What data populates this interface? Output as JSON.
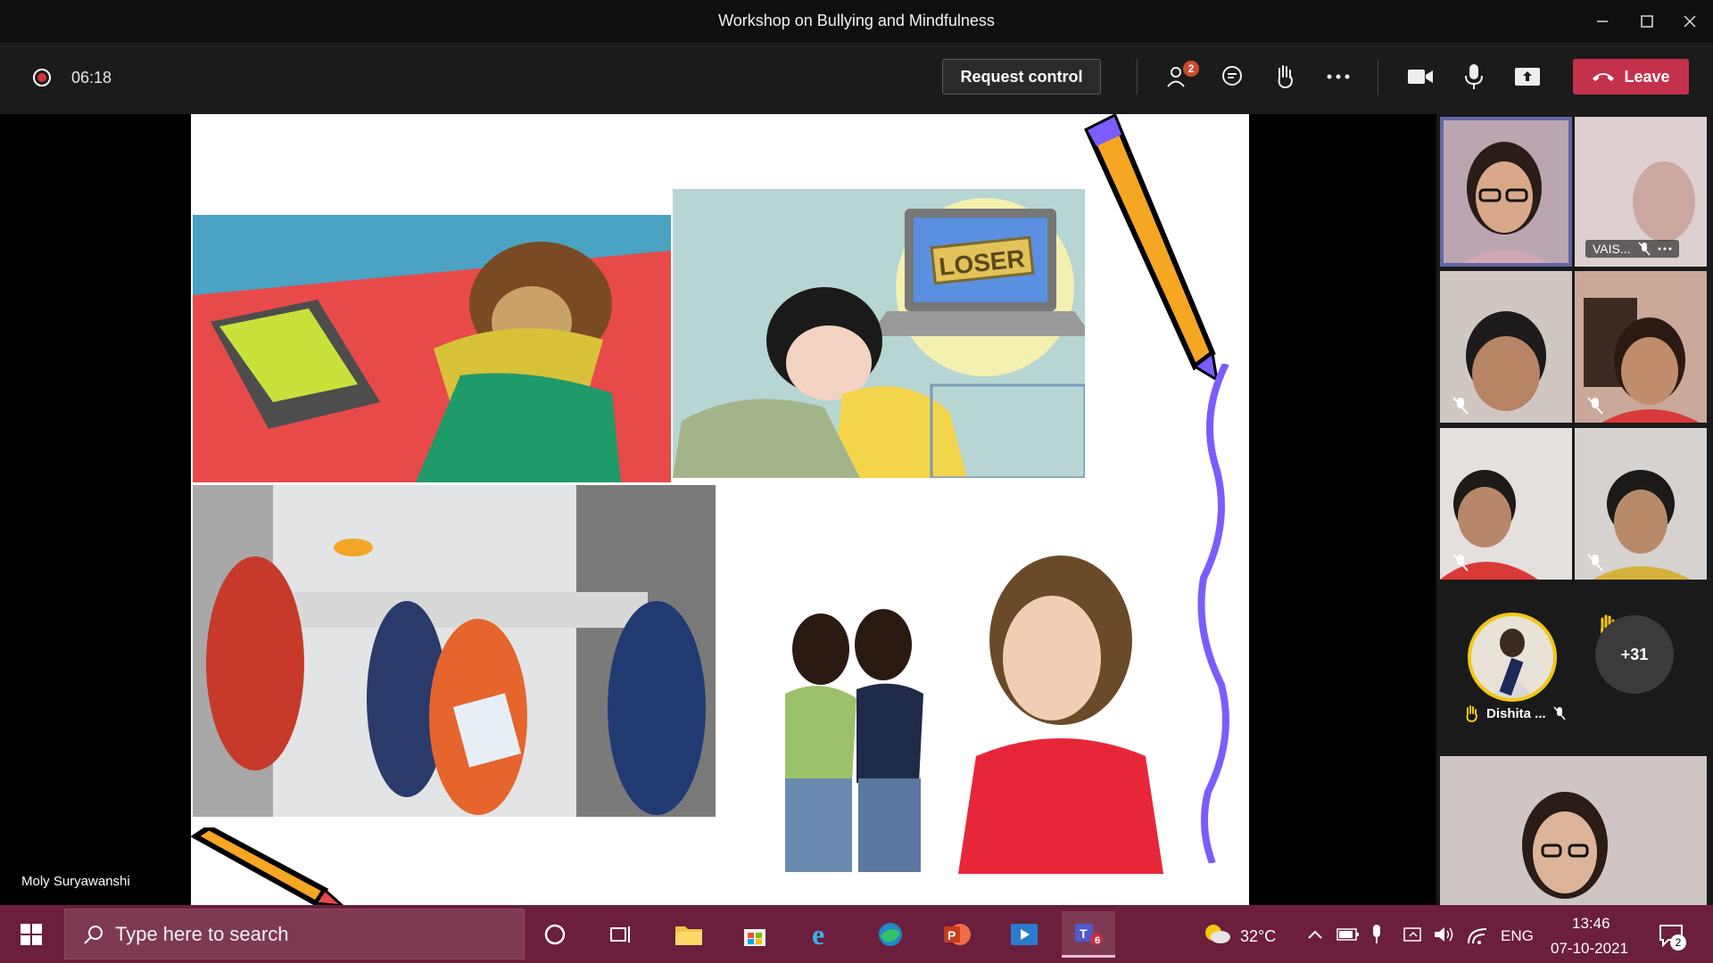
{
  "window": {
    "title": "Workshop on Bullying and Mindfulness"
  },
  "toolbar": {
    "timer": "06:18",
    "request_control_label": "Request control",
    "participants_badge": "2",
    "leave_label": "Leave"
  },
  "stage": {
    "presenter_name": "Moly Suryawanshi",
    "slide_text": {
      "laptop_screen": "LOSER"
    }
  },
  "participants": {
    "tile_label_1": "VAIS...",
    "avatar_name": "Dishita ...",
    "overflow_count": "+31"
  },
  "taskbar": {
    "search_placeholder": "Type here to search",
    "teams_badge": "6",
    "weather": "32°C",
    "language": "ENG",
    "time": "13:46",
    "date": "07-10-2021",
    "notifications_count": "2"
  },
  "colors": {
    "leave": "#c4314b",
    "taskbar": "#6b1f3c",
    "active_speaker_outline": "#6264a7",
    "raise_hand": "#f2c811"
  }
}
